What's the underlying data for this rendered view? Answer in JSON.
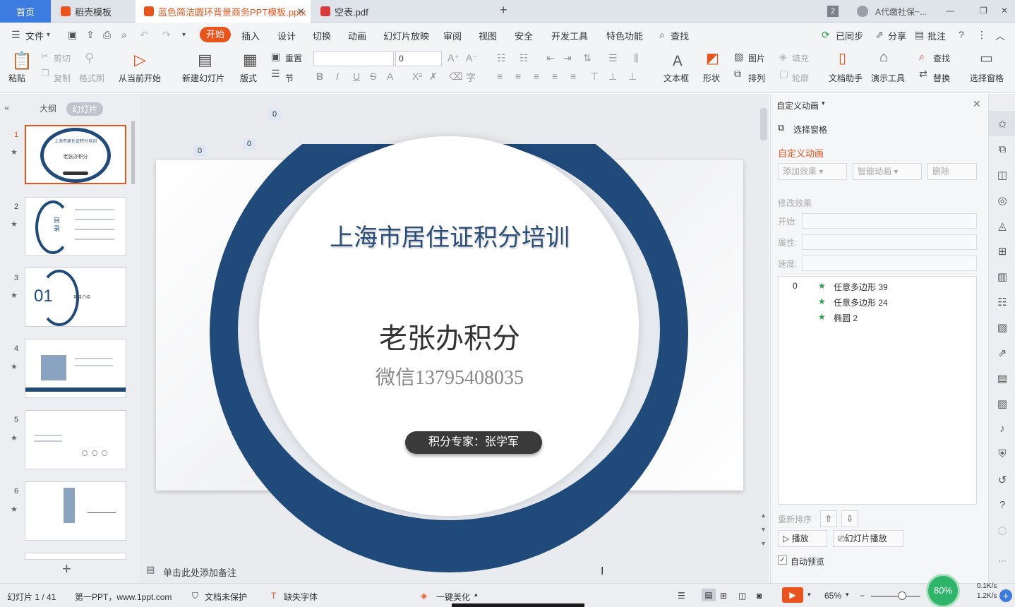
{
  "tabs": {
    "home": "首页",
    "templates": "稻壳模板",
    "document": "蓝色简洁圆环背景商务PPT模板.pptx",
    "pdf": "空表.pdf",
    "window_count": "2",
    "account": "A代缴社保~..."
  },
  "menubar": {
    "file": "文件",
    "start": "开始",
    "items": [
      "插入",
      "设计",
      "切换",
      "动画",
      "幻灯片放映",
      "审阅",
      "视图",
      "安全",
      "开发工具",
      "特色功能"
    ],
    "search": "查找",
    "sync": "已同步",
    "share": "分享",
    "comment": "批注"
  },
  "ribbon": {
    "paste": "粘贴",
    "cut": "剪切",
    "copy": "复制",
    "format_painter": "格式刷",
    "from_current": "从当前开始",
    "new_slide": "新建幻灯片",
    "layout": "版式",
    "reset": "重置",
    "section": "节",
    "font_size": "0",
    "textbox": "文本框",
    "shape": "形状",
    "picture": "图片",
    "arrange": "排列",
    "fill": "填充",
    "outline": "轮廓",
    "doc_helper": "文档助手",
    "presentation_tools": "演示工具",
    "find": "查找",
    "replace": "替换",
    "select_pane": "选择窗格"
  },
  "leftpanel": {
    "outline_tab": "大纲",
    "slides_tab": "幻灯片",
    "slides": [
      {
        "num": "1",
        "title": "上海市居住证积分培训",
        "subtitle": "老张办积分"
      },
      {
        "num": "2",
        "title": "目录"
      },
      {
        "num": "3",
        "title": "01",
        "subtitle": "项目介绍"
      },
      {
        "num": "4"
      },
      {
        "num": "5"
      },
      {
        "num": "6"
      }
    ],
    "add_symbol": "+"
  },
  "slide": {
    "title": "上海市居住证积分培训",
    "name": "老张办积分",
    "wechat": "微信13795408035",
    "expert": "积分专家：张学军",
    "anim_tags": [
      "0",
      "0",
      "0"
    ],
    "notes_placeholder": "单击此处添加备注",
    "colors": {
      "ring": "#1f4a7a",
      "circle": "#ffffff",
      "title": "#2a4d7a"
    }
  },
  "rightpanel": {
    "header": "自定义动画",
    "select_pane": "选择窗格",
    "section_title": "自定义动画",
    "add_effect": "添加效果",
    "smart_anim": "智能动画",
    "delete": "删除",
    "modify_effect": "修改效果",
    "start_label": "开始:",
    "property_label": "属性:",
    "speed_label": "速度:",
    "anim_list": [
      {
        "order": "0",
        "name": "任意多边形 39"
      },
      {
        "order": "",
        "name": "任意多边形 24"
      },
      {
        "order": "",
        "name": "椭圆 2"
      }
    ],
    "reorder": "重新排序",
    "play": "播放",
    "slideshow": "幻灯片播放",
    "autopreview": "自动预览"
  },
  "statusbar": {
    "slide_info": "幻灯片 1 / 41",
    "theme": "第一PPT，www.1ppt.com",
    "unprotected": "文档未保护",
    "missing_font": "缺失字体",
    "beautify": "一键美化",
    "zoom": "65%",
    "cpu": "80%",
    "net_up": "0.1K/s",
    "net_down": "1.2K/s"
  }
}
